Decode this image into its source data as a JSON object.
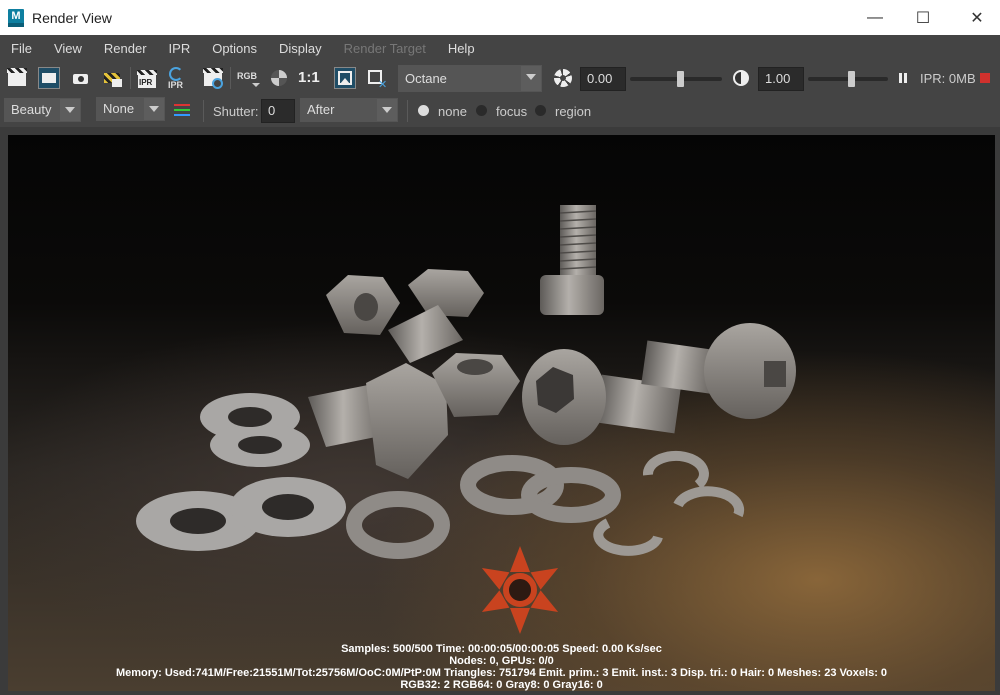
{
  "window": {
    "app_icon_letter": "M",
    "title": "Render View",
    "minimize": "—",
    "maximize": "☐",
    "close": "✕"
  },
  "menu": [
    "File",
    "View",
    "Render",
    "IPR",
    "Options",
    "Display",
    "Render Target",
    "Help"
  ],
  "toolbar": {
    "rgb_label": "RGB",
    "ratio_label": "1:1",
    "ipr_label": "IPR",
    "renderer": "Octane",
    "exposure_value": "0.00",
    "exposure_slider_fraction": 0.55,
    "gamma_value": "1.00",
    "gamma_slider_fraction": 0.55,
    "ipr_memory": "IPR: 0MB",
    "stop_color": "#d0312d"
  },
  "toolbar2": {
    "pass": "Beauty",
    "layer": "None",
    "shutter_label": "Shutter:",
    "shutter_value": "0",
    "shutter_mode": "After",
    "radio_none": "none",
    "radio_focus": "focus",
    "radio_region": "region"
  },
  "render_stats": {
    "line1": "Samples: 500/500 Time: 00:00:05/00:00:05 Speed: 0.00 Ks/sec",
    "line2": "Nodes: 0, GPUs: 0/0",
    "line3": "Memory: Used:741M/Free:21551M/Tot:25756M/OoC:0M/PtP:0M Triangles: 751794 Emit. prim.: 3 Emit. inst.: 3 Disp. tri.: 0 Hair: 0 Meshes: 23 Voxels: 0",
    "line4": "RGB32: 2 RGB64: 0 Gray8: 0 Gray16: 0"
  },
  "render_scene": {
    "bolt_color": "#8d8a86",
    "logo_color": "#c9431f"
  }
}
